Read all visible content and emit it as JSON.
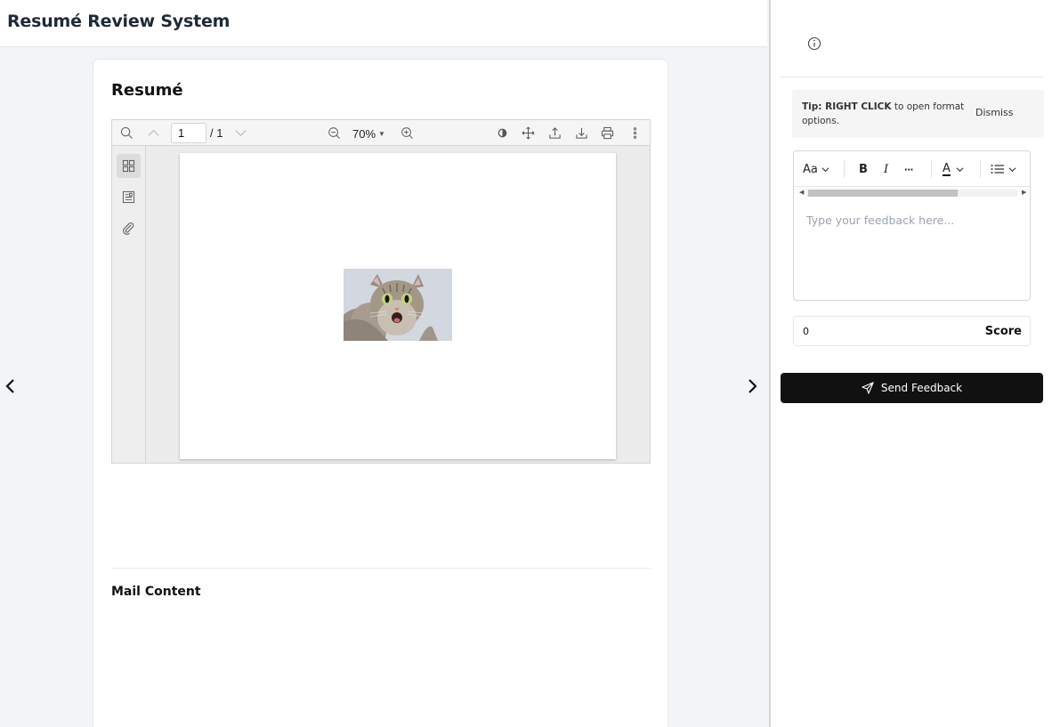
{
  "app": {
    "title": "Resumé Review System"
  },
  "navigation": {
    "prev_icon": "chevron-left-icon",
    "next_icon": "chevron-right-icon"
  },
  "resume_card": {
    "title": "Resumé",
    "viewer": {
      "current_page": "1",
      "total_pages": "/ 1",
      "zoom": "70%",
      "toolbar_icons": [
        "search-icon",
        "page-up-icon",
        "page-down-icon",
        "zoom-out-icon",
        "zoom-in-icon",
        "annotate-icon",
        "pan-icon",
        "upload-icon",
        "download-icon",
        "print-icon",
        "more-icon"
      ],
      "sidebar_icons": [
        "thumbnails-icon",
        "outline-icon",
        "attachment-icon"
      ],
      "page_image": "cat-photo"
    },
    "mail_content_title": "Mail Content"
  },
  "feedback_panel": {
    "info_icon": "info-icon",
    "tip": {
      "prefix": "Tip: RIGHT CLICK",
      "text": " to open format options.",
      "dismiss_label": "Dismiss"
    },
    "editor": {
      "font_label": "Aa",
      "bold_label": "B",
      "italic_label": "I",
      "more_label": "···",
      "font_color_label": "A",
      "placeholder": "Type your feedback here..."
    },
    "score": {
      "value": "0",
      "label": "Score"
    },
    "send_button_label": "Send Feedback"
  },
  "colors": {
    "primary_button": "#111111",
    "background": "#f3f4f6",
    "panel": "#ffffff"
  }
}
